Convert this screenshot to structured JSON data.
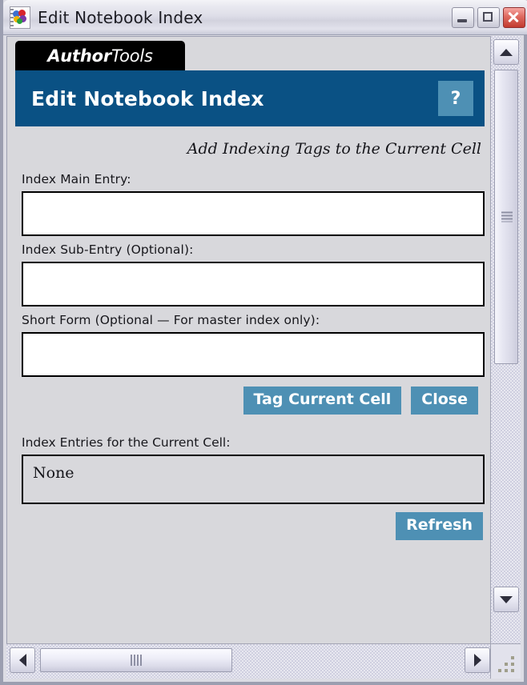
{
  "window": {
    "title": "Edit Notebook Index",
    "icon": "notebook-icon",
    "minimize_label": "Minimize",
    "maximize_label": "Maximize",
    "close_label": "Close"
  },
  "brand": {
    "name_bold": "Author",
    "name_light": "Tools"
  },
  "banner": {
    "title": "Edit Notebook Index",
    "help_label": "?",
    "background_color": "#0a5184",
    "help_color": "#4e90b4"
  },
  "form": {
    "subtitle": "Add Indexing Tags to the Current Cell",
    "fields": [
      {
        "label": "Index Main Entry:",
        "value": "",
        "placeholder": ""
      },
      {
        "label": "Index Sub-Entry (Optional):",
        "value": "",
        "placeholder": ""
      },
      {
        "label": "Short Form (Optional — For master index only):",
        "value": "",
        "placeholder": ""
      }
    ],
    "tag_button_label": "Tag Current Cell",
    "close_button_label": "Close",
    "entries_label": "Index Entries for the Current Cell:",
    "entries_value": "None",
    "refresh_button_label": "Refresh",
    "button_color": "#4e90b4"
  },
  "scrollbars": {
    "vertical": {
      "up_icon": "chevron-up-icon",
      "down_icon": "chevron-down-icon",
      "thumb_grip_icon": "grip-lines-icon"
    },
    "horizontal": {
      "left_icon": "chevron-left-icon",
      "right_icon": "chevron-right-icon",
      "thumb_grip_icon": "grip-lines-icon"
    },
    "resize_grip_icon": "resize-grip-icon"
  }
}
